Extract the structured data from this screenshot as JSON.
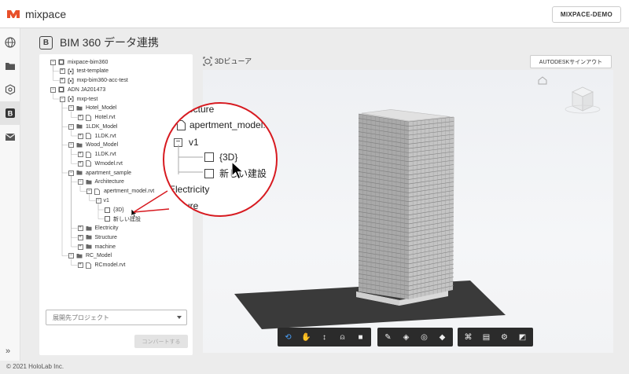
{
  "app": {
    "name": "mixpace",
    "user": "MIXPACE-DEMO"
  },
  "page": {
    "title": "BIM 360 データ連携"
  },
  "tree": {
    "items": [
      {
        "label": "mixpace-bim360",
        "level": 0,
        "toggle": "−",
        "icon": "hub"
      },
      {
        "label": "test-template",
        "level": 1,
        "toggle": "+",
        "icon": "project"
      },
      {
        "label": "mxp-bim360-acc-test",
        "level": 1,
        "toggle": "+",
        "icon": "project"
      },
      {
        "label": "ADN JA201473",
        "level": 0,
        "toggle": "−",
        "icon": "hub"
      },
      {
        "label": "mxp-test",
        "level": 1,
        "toggle": "−",
        "icon": "project"
      },
      {
        "label": "Hotel_Model",
        "level": 2,
        "toggle": "−",
        "icon": "folder"
      },
      {
        "label": "Hotel.rvt",
        "level": 3,
        "toggle": "+",
        "icon": "file"
      },
      {
        "label": "1LDK_Model",
        "level": 2,
        "toggle": "−",
        "icon": "folder"
      },
      {
        "label": "1LDK.rvt",
        "level": 3,
        "toggle": "+",
        "icon": "file"
      },
      {
        "label": "Wood_Model",
        "level": 2,
        "toggle": "−",
        "icon": "folder"
      },
      {
        "label": "1LDK.rvt",
        "level": 3,
        "toggle": "+",
        "icon": "file"
      },
      {
        "label": "Wmodel.rvt",
        "level": 3,
        "toggle": "+",
        "icon": "file"
      },
      {
        "label": "apartment_sample",
        "level": 2,
        "toggle": "−",
        "icon": "folder"
      },
      {
        "label": "Architecture",
        "level": 3,
        "toggle": "−",
        "icon": "folder"
      },
      {
        "label": "apertment_model.rvt",
        "level": 4,
        "toggle": "−",
        "icon": "file"
      },
      {
        "label": "v1",
        "level": 5,
        "toggle": "−",
        "icon": "none"
      },
      {
        "label": "{3D}",
        "level": 6,
        "toggle": "",
        "icon": "checkbox"
      },
      {
        "label": "新しい建設",
        "level": 6,
        "toggle": "",
        "icon": "checkbox"
      },
      {
        "label": "Electricity",
        "level": 3,
        "toggle": "+",
        "icon": "folder"
      },
      {
        "label": "Structure",
        "level": 3,
        "toggle": "+",
        "icon": "folder"
      },
      {
        "label": "machine",
        "level": 3,
        "toggle": "+",
        "icon": "folder"
      },
      {
        "label": "RC_Model",
        "level": 2,
        "toggle": "−",
        "icon": "folder"
      },
      {
        "label": "RCmodel.rvt",
        "level": 3,
        "toggle": "+",
        "icon": "file"
      }
    ]
  },
  "zoom": {
    "lines": [
      {
        "text": "itecture",
        "kind": "text"
      },
      {
        "text": "apertment_model.rvt",
        "kind": "file"
      },
      {
        "text": "v1",
        "kind": "toggle"
      },
      {
        "text": "{3D}",
        "kind": "checkbox"
      },
      {
        "text": "新しい建設",
        "kind": "checkbox"
      },
      {
        "text": "Electricity",
        "kind": "text"
      },
      {
        "text": "ucture",
        "kind": "text"
      }
    ]
  },
  "project_select": {
    "placeholder": "展開先プロジェクト"
  },
  "convert_button": {
    "label": "コンバートする",
    "disabled": true
  },
  "viewer": {
    "label": "3Dビューア",
    "autodesk_button": "AUTODESKサインアウト"
  },
  "toolbar": {
    "groups": [
      [
        {
          "icon": "orbit-icon",
          "active": true
        },
        {
          "icon": "pan-icon"
        },
        {
          "icon": "zoom-icon"
        },
        {
          "icon": "first-person-icon"
        },
        {
          "icon": "camera-icon"
        }
      ],
      [
        {
          "icon": "measure-icon"
        },
        {
          "icon": "section-icon"
        },
        {
          "icon": "explode-icon"
        },
        {
          "icon": "model-browser-icon"
        }
      ],
      [
        {
          "icon": "structure-icon"
        },
        {
          "icon": "properties-icon"
        },
        {
          "icon": "settings-icon"
        },
        {
          "icon": "fullscreen-icon"
        }
      ]
    ]
  },
  "footer": {
    "copyright": "© 2021 HoloLab Inc."
  }
}
